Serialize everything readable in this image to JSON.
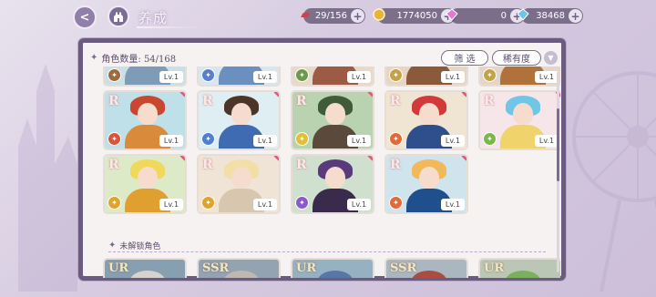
{
  "header": {
    "title": "养成",
    "resources": [
      {
        "name": "stamina",
        "icon": "meat-icon",
        "value": "29/156",
        "color": "#c9444c"
      },
      {
        "name": "gold",
        "icon": "coin-icon",
        "value": "1774050",
        "color": "#e4b53a"
      },
      {
        "name": "gem_paid",
        "icon": "pink-diamond-icon",
        "value": "0",
        "color": "#e07ad8"
      },
      {
        "name": "gem",
        "icon": "diamond-icon",
        "value": "38468",
        "color": "#6ec4e8"
      }
    ]
  },
  "panel": {
    "count_label": "角色数量: 54/168",
    "filter_button": "筛 选",
    "sort_button": "稀有度",
    "locked_section_label": "未解锁角色"
  },
  "cards": [
    {
      "rank": "",
      "level": "Lv.1",
      "element_color": "#9c6b3e",
      "hair": "#c9875a",
      "outfit": "#7e9bb8",
      "bg": "#c8e0e6"
    },
    {
      "rank": "",
      "level": "Lv.1",
      "element_color": "#5a7ec9",
      "hair": "#8a6a54",
      "outfit": "#6b8fc1",
      "bg": "#d8e6ee"
    },
    {
      "rank": "",
      "level": "Lv.1",
      "element_color": "#6b9a4e",
      "hair": "#b04b3a",
      "outfit": "#9d5b45",
      "bg": "#e8d9c8"
    },
    {
      "rank": "",
      "level": "Lv.1",
      "element_color": "#c2a34a",
      "hair": "#c46a3a",
      "outfit": "#8b5a3a",
      "bg": "#e8d6c4"
    },
    {
      "rank": "",
      "level": "Lv.1",
      "element_color": "#c2a34a",
      "hair": "#d9b84e",
      "outfit": "#b0723a",
      "bg": "#e3d6c9"
    },
    {
      "rank": "R",
      "level": "Lv.1",
      "element_color": "#d7553a",
      "hair": "#c9462f",
      "outfit": "#d98a3a",
      "bg": "#bfe0e8"
    },
    {
      "rank": "R",
      "level": "Lv.1",
      "element_color": "#4f7fd1",
      "hair": "#4a3528",
      "outfit": "#3f6bb3",
      "bg": "#dfeef3"
    },
    {
      "rank": "R",
      "level": "Lv.1",
      "element_color": "#e0c038",
      "hair": "#3f5b3a",
      "outfit": "#5b4a3c",
      "bg": "#b9d3b0"
    },
    {
      "rank": "R",
      "level": "Lv.1",
      "element_color": "#e06a3a",
      "hair": "#d23a3a",
      "outfit": "#2f4f8c",
      "bg": "#f0e4d2"
    },
    {
      "rank": "R",
      "level": "Lv.1",
      "element_color": "#7ab84a",
      "hair": "#6fc6e6",
      "outfit": "#f0d36a",
      "bg": "#f6e6ea"
    },
    {
      "rank": "R",
      "level": "Lv.1",
      "element_color": "#e0a32e",
      "hair": "#f0d85a",
      "outfit": "#e0a030",
      "bg": "#dceac8"
    },
    {
      "rank": "R",
      "level": "Lv.1",
      "element_color": "#e0a32e",
      "hair": "#f2dfa8",
      "outfit": "#d8c6ae",
      "bg": "#efe4d6"
    },
    {
      "rank": "R",
      "level": "Lv.1",
      "element_color": "#8b5ac9",
      "hair": "#5b3a7c",
      "outfit": "#3a2a4c",
      "bg": "#cfe0cf"
    },
    {
      "rank": "R",
      "level": "Lv.1",
      "element_color": "#e06a3a",
      "hair": "#f2b85a",
      "outfit": "#1f4f8c",
      "bg": "#cfe4ec"
    }
  ],
  "locked_cards": [
    {
      "rank": "UR",
      "hair": "#d8d2cc",
      "bg": "#7fa0b8"
    },
    {
      "rank": "SSR",
      "hair": "#bfb8b0",
      "bg": "#8ea4b8"
    },
    {
      "rank": "UR",
      "hair": "#4f77b8",
      "bg": "#8fb2c8"
    },
    {
      "rank": "SSR",
      "hair": "#c4463a",
      "bg": "#a8b8c4"
    },
    {
      "rank": "UR",
      "hair": "#6fb64a",
      "bg": "#b8c8b0"
    }
  ]
}
